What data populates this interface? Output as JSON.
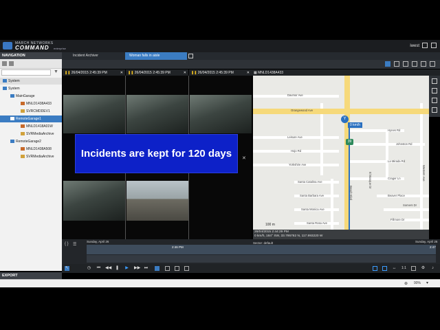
{
  "app": {
    "brand_line1": "MARCH NETWORKS",
    "brand_line2": "COMMAND",
    "brand_line3": "enterprise",
    "user": "iwest"
  },
  "nav": {
    "header": "NAVIGATION",
    "export": "EXPORT",
    "items": [
      {
        "label": "System",
        "level": 0,
        "selected": false
      },
      {
        "label": "System",
        "level": 1,
        "selected": false
      },
      {
        "label": "MainGarage",
        "level": 2,
        "selected": false
      },
      {
        "label": "MNLD1438A433",
        "level": 3,
        "selected": false
      },
      {
        "label": "SVRCMDDEV1",
        "level": 3,
        "selected": false
      },
      {
        "label": "RemoteGarage1",
        "level": 2,
        "selected": true
      },
      {
        "label": "MNLD1418A01W",
        "level": 3,
        "selected": false
      },
      {
        "label": "SVRMediaArchive",
        "level": 3,
        "selected": false
      },
      {
        "label": "RemoteGarage2",
        "level": 2,
        "selected": false
      },
      {
        "label": "MNLD1438A508",
        "level": 3,
        "selected": false
      },
      {
        "label": "SVRMediaArchive",
        "level": 3,
        "selected": false
      }
    ]
  },
  "tabs": [
    {
      "label": "Incident Archiver",
      "active": false
    },
    {
      "label": "Woman falls in aisle",
      "active": true
    }
  ],
  "video_headers": [
    "26/04/2015 2:45:39 PM",
    "26/04/2015 2:45:39 PM",
    "26/04/2015 2:45:39 PM"
  ],
  "map": {
    "title": "MNLD1438A433",
    "speed_badge": "0 km/h",
    "route": "39",
    "scale": "100 m",
    "streets": {
      "davmor": "Davmor Ave",
      "orangewood": "Orangewood Ave",
      "leisure": "Leisure Ave",
      "hojo": "Hojo Rd",
      "yorkshire": "Yorkshire Ave",
      "santa_catalina": "Santa Catalina Ave",
      "santa_barbara": "Santa Barbara Ave",
      "santa_monica": "Santa Monica Ave",
      "santa_rosa": "Santa Rosa Ave",
      "beach": "Beach Blvd",
      "hynes": "Hynes Rd",
      "johnston": "Johnston Rd",
      "la_mirada": "La Mirada Rd",
      "crager": "Crager Ln",
      "beaver": "Beaver Place",
      "somers": "Somers Dr",
      "fillmore": "Fillmore Dr",
      "western": "Western Ave",
      "el_bosque": "El Bosque Dr"
    },
    "info_line1": "26/04/2015 2:44:29 PM",
    "info_line2": "0 km/h, 184° SW, 33.795762 N, 117.993220 W"
  },
  "banner": "Incidents are kept for 120 days",
  "timeline": {
    "left_date": "Sunday, April 26",
    "right_date": "Sunday, April 26",
    "cursor_time": "2:46 PM",
    "sector": "Sector: default",
    "right_time": "2:47"
  },
  "status": {
    "zoom": "90%"
  }
}
